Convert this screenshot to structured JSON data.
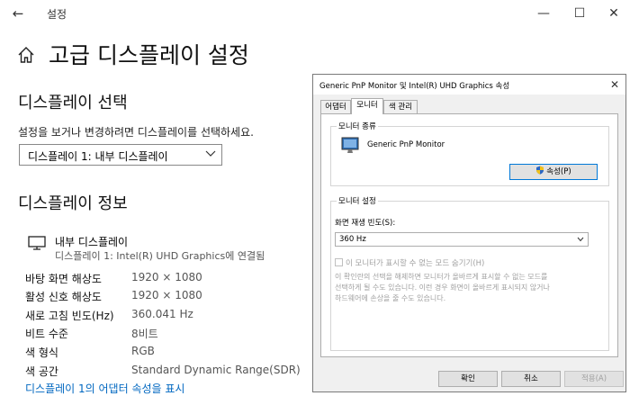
{
  "window": {
    "app_title": "설정",
    "back_icon": "←",
    "minimize_icon": "—",
    "maximize_icon": "☐",
    "close_icon": "✕"
  },
  "page": {
    "title": "고급 디스플레이 설정"
  },
  "select_display": {
    "heading": "디스플레이 선택",
    "description": "설정을 보거나 변경하려면 디스플레이를 선택하세요.",
    "selected": "디스플레이 1: 내부 디스플레이"
  },
  "display_info": {
    "heading": "디스플레이 정보",
    "name": "내부 디스플레이",
    "connection": "디스플레이 1: Intel(R) UHD Graphics에 연결됨",
    "rows": [
      {
        "label": "바탕 화면 해상도",
        "value": "1920 × 1080"
      },
      {
        "label": "활성 신호 해상도",
        "value": "1920 × 1080"
      },
      {
        "label": "새로 고침 빈도(Hz)",
        "value": "360.041 Hz"
      },
      {
        "label": "비트 수준",
        "value": "8비트"
      },
      {
        "label": "색 형식",
        "value": "RGB"
      },
      {
        "label": "색 공간",
        "value": "Standard Dynamic Range(SDR)"
      }
    ],
    "adapter_link": "디스플레이 1의 어댑터 속성을 표시"
  },
  "dialog": {
    "title": "Generic PnP Monitor 및 Intel(R) UHD Graphics 속성",
    "close_icon": "✕",
    "tabs": [
      "어댑터",
      "모니터",
      "색 관리"
    ],
    "active_tab": 1,
    "monitor_type_label": "모니터 종류",
    "monitor_name": "Generic PnP Monitor",
    "properties_button": "속성(P)",
    "monitor_settings_label": "모니터 설정",
    "refresh_rate_label": "화면 재생 빈도(S):",
    "refresh_rate_value": "360 Hz",
    "hide_modes_label": "이 모니터가 표시할 수 없는 모드 숨기기(H)",
    "hide_modes_checked": false,
    "warning_lines": [
      "이 확인란의 선택을 해제하면 모니터가 올바르게 표시할 수 없는 모드를",
      "선택하게 될 수도 있습니다. 이런 경우 화면이 올바르게 표시되지 않거나",
      "하드웨어에 손상을 줄 수도 있습니다."
    ],
    "buttons": {
      "ok": "확인",
      "cancel": "취소",
      "apply": "적용(A)"
    }
  },
  "icons": {
    "home": "home-icon",
    "monitor": "monitor-icon",
    "shield": "uac-shield-icon",
    "chevron": "chevron-down-icon"
  }
}
